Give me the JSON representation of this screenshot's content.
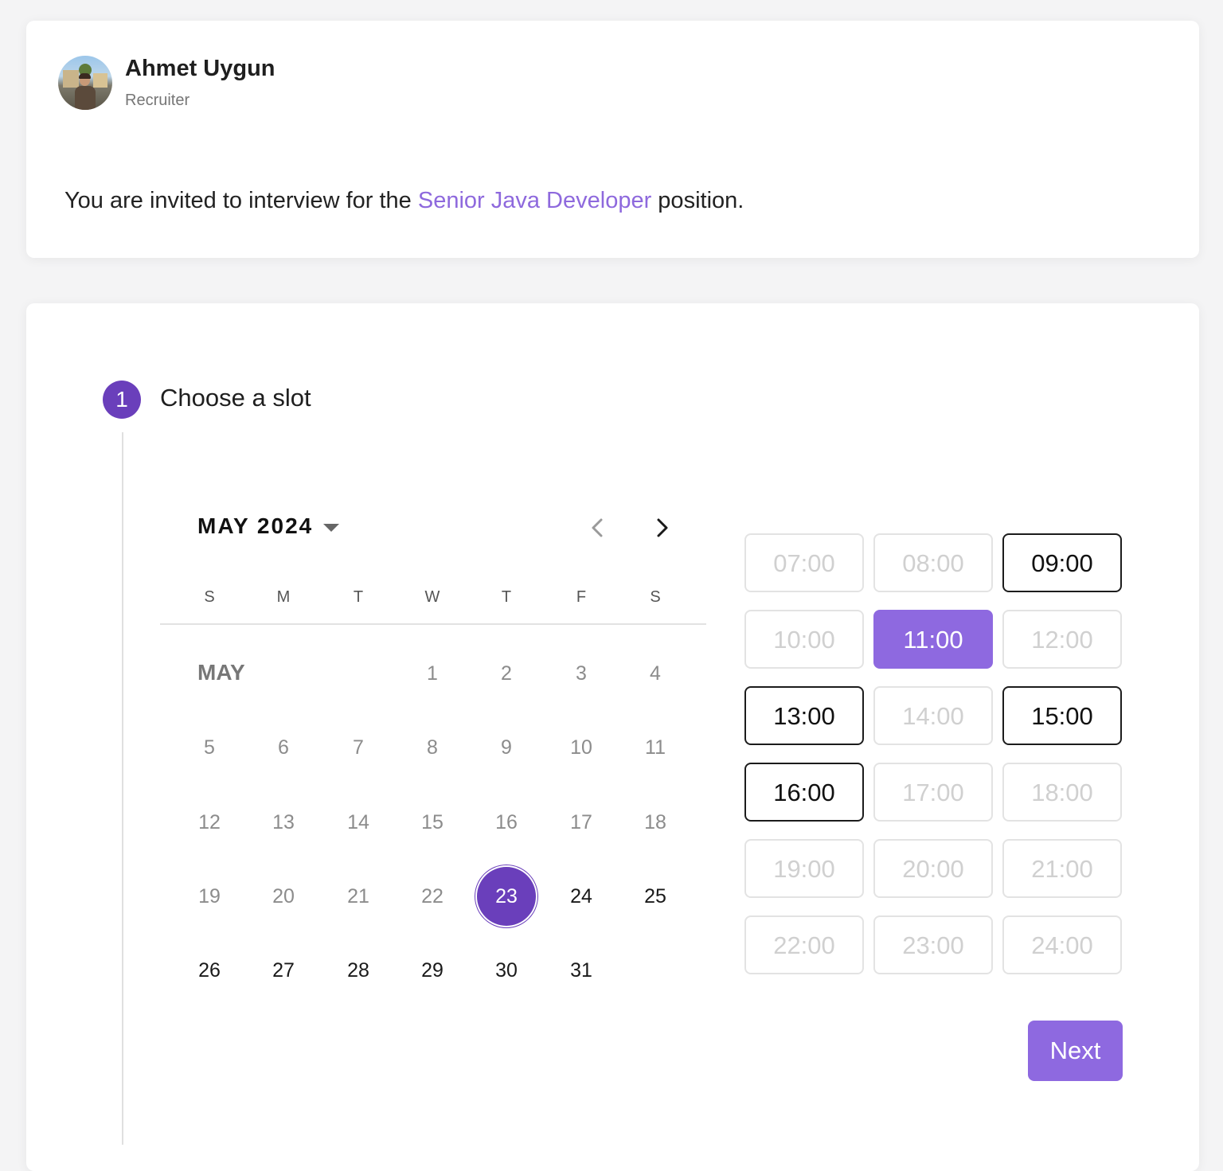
{
  "recruiter": {
    "name": "Ahmet Uygun",
    "role": "Recruiter"
  },
  "invitation": {
    "prefix": "You are invited to interview for the",
    "position": "Senior Java Developer",
    "suffix": " position."
  },
  "step": {
    "number": "1",
    "title": "Choose a slot"
  },
  "calendar": {
    "month_year": "MAY 2024",
    "prev_icon": "chevron-left-icon",
    "next_icon": "chevron-right-icon",
    "weekdays": [
      "S",
      "M",
      "T",
      "W",
      "T",
      "F",
      "S"
    ],
    "month_label": "MAY",
    "days": [
      "1",
      "2",
      "3",
      "4",
      "5",
      "6",
      "7",
      "8",
      "9",
      "10",
      "11",
      "12",
      "13",
      "14",
      "15",
      "16",
      "17",
      "18",
      "19",
      "20",
      "21",
      "22",
      "23",
      "24",
      "25",
      "26",
      "27",
      "28",
      "29",
      "30",
      "31"
    ],
    "selected_day": "23"
  },
  "slots": [
    {
      "label": "07:00",
      "state": "disabled"
    },
    {
      "label": "08:00",
      "state": "disabled"
    },
    {
      "label": "09:00",
      "state": "available"
    },
    {
      "label": "10:00",
      "state": "disabled"
    },
    {
      "label": "11:00",
      "state": "selected"
    },
    {
      "label": "12:00",
      "state": "disabled"
    },
    {
      "label": "13:00",
      "state": "available"
    },
    {
      "label": "14:00",
      "state": "disabled"
    },
    {
      "label": "15:00",
      "state": "available"
    },
    {
      "label": "16:00",
      "state": "available"
    },
    {
      "label": "17:00",
      "state": "disabled"
    },
    {
      "label": "18:00",
      "state": "disabled"
    },
    {
      "label": "19:00",
      "state": "disabled"
    },
    {
      "label": "20:00",
      "state": "disabled"
    },
    {
      "label": "21:00",
      "state": "disabled"
    },
    {
      "label": "22:00",
      "state": "disabled"
    },
    {
      "label": "23:00",
      "state": "disabled"
    },
    {
      "label": "24:00",
      "state": "disabled"
    }
  ],
  "actions": {
    "next_label": "Next"
  },
  "colors": {
    "accent": "#8e69e0",
    "accent_dark": "#6a3fbb"
  }
}
